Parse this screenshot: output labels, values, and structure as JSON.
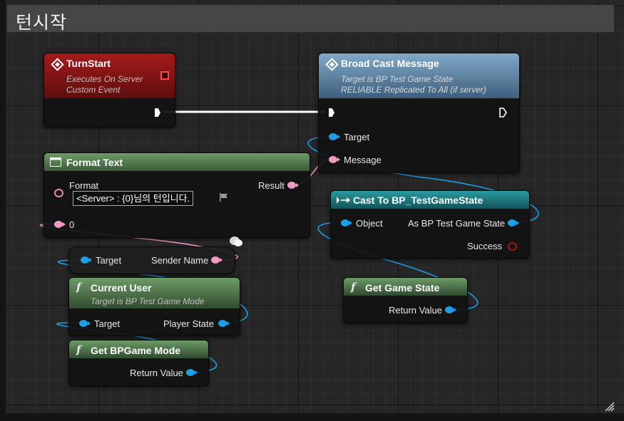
{
  "window": {
    "title": "턴시작"
  },
  "nodes": {
    "turnstart": {
      "title": "TurnStart",
      "sub1": "Executes On Server",
      "sub2": "Custom Event"
    },
    "broadcast": {
      "title": "Broad Cast Message",
      "sub1": "Target is BP Test Game State",
      "sub2": "RELIABLE Replicated To All (if server)",
      "pin_target": "Target",
      "pin_message": "Message"
    },
    "formattext": {
      "title": "Format Text",
      "pin_format": "Format",
      "format_value": "<Server> : {0}님의 턴입니다.",
      "pin_result": "Result",
      "pin_0": "0"
    },
    "cast": {
      "title": "Cast To BP_TestGameState",
      "pin_object": "Object",
      "pin_as": "As BP Test Game State",
      "pin_success": "Success"
    },
    "sendername": {
      "pin_target": "Target",
      "pin_sender": "Sender Name"
    },
    "currentuser": {
      "title": "Current User",
      "sub": "Target is BP Test Game Mode",
      "pin_target": "Target",
      "pin_playerstate": "Player State"
    },
    "getgamestate": {
      "title": "Get Game State",
      "pin_return": "Return Value"
    },
    "getgamemode": {
      "title": "Get BPGame Mode",
      "pin_return": "Return Value"
    }
  },
  "colors": {
    "event_header": "#8a1414",
    "function_header": "#4f8c4a",
    "cast_header": "#1c7d86",
    "pure_header": "#49694a",
    "object_pin": "#1e9ee8",
    "text_pin": "#f19ac4",
    "exec_wire": "#ffffff"
  }
}
